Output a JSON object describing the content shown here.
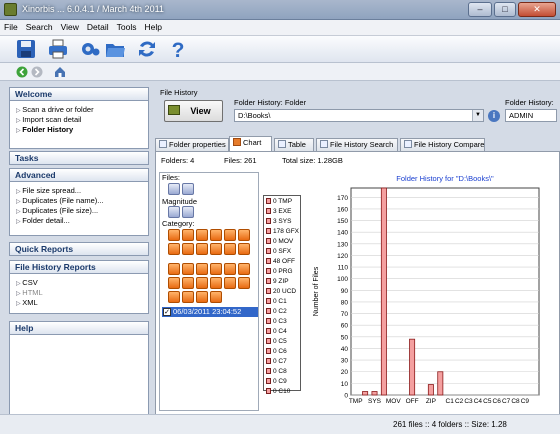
{
  "window": {
    "title": "Xinorbis ... 6.0.4.1 / March 4th 2011",
    "min": "–",
    "max": "□",
    "close": "✕"
  },
  "menu": [
    "File",
    "Search",
    "View",
    "Detail",
    "Tools",
    "Help"
  ],
  "toolbar": {
    "icons": [
      "save-icon",
      "print-icon",
      "settings-icon",
      "open-folder-icon",
      "refresh-icon",
      "help-icon"
    ]
  },
  "sidebar": {
    "welcome": {
      "title": "Welcome",
      "items": [
        "Scan a drive or folder",
        "Import scan detail",
        "Folder History"
      ]
    },
    "tasks": {
      "title": "Tasks"
    },
    "advanced": {
      "title": "Advanced",
      "items": [
        "File size spread...",
        "Duplicates (File name)...",
        "Duplicates (File size)...",
        "Folder detail..."
      ]
    },
    "quick_reports": {
      "title": "Quick Reports"
    },
    "file_history_reports": {
      "title": "File History Reports",
      "items": [
        "CSV",
        "HTML",
        "XML"
      ]
    },
    "help": {
      "title": "Help"
    }
  },
  "file_history": {
    "label": "File History",
    "view_button": "View",
    "folder_label": "Folder History: Folder",
    "folder_value": "D:\\Books\\",
    "user_label": "Folder History:",
    "user_value": "ADMIN"
  },
  "tabs": [
    "Folder properties",
    "Chart",
    "Table",
    "File History Search",
    "File History Compare"
  ],
  "stats": {
    "folders": "Folders:  4",
    "files": "Files:  261",
    "total": "Total size:  1.28GB"
  },
  "left_panel": {
    "files_label": "Files:",
    "magnitude_label": "Magnitude",
    "category_label": "Category:",
    "date": "06/03/2011 23:04:52",
    "checked": "✓"
  },
  "legend": [
    "0 TMP",
    "3 EXE",
    "3 SYS",
    "178 GFX",
    "0 MOV",
    "0 SFX",
    "48 OFF",
    "0 PRG",
    "9 ZIP",
    "20 UCD",
    "0 C1",
    "0 C2",
    "0 C3",
    "0 C4",
    "0 C5",
    "0 C6",
    "0 C7",
    "0 C8",
    "0 C9",
    "0 C10"
  ],
  "chart_data": {
    "type": "bar",
    "title": "Folder History for \"D:\\Books\\\"",
    "ylabel": "Number of Files",
    "xlabel": "",
    "ylim": [
      0,
      178
    ],
    "yticks": [
      0,
      10,
      20,
      30,
      40,
      50,
      60,
      70,
      80,
      90,
      100,
      110,
      120,
      130,
      140,
      150,
      160,
      170
    ],
    "categories": [
      "TMP",
      "EXE",
      "SYS",
      "GFX",
      "MOV",
      "SFX",
      "OFF",
      "PRG",
      "ZIP",
      "UCD",
      "C1",
      "C2",
      "C3",
      "C4",
      "C5",
      "C6",
      "C7",
      "C8",
      "C9",
      "C10"
    ],
    "values": [
      0,
      3,
      3,
      178,
      0,
      0,
      48,
      0,
      9,
      20,
      0,
      0,
      0,
      0,
      0,
      0,
      0,
      0,
      0,
      0
    ],
    "visible_xlabels": [
      "TMP",
      "SYS",
      "MOV",
      "OFF",
      "ZIP",
      "C1",
      "C2",
      "C3",
      "C4",
      "C5",
      "C6",
      "C7",
      "C8",
      "C9"
    ],
    "bar_color": "#f4a0a0",
    "bar_edge": "#8b1a1a"
  },
  "status": {
    "text": "261 files  ::  4 folders  ::  Size: 1.28"
  }
}
